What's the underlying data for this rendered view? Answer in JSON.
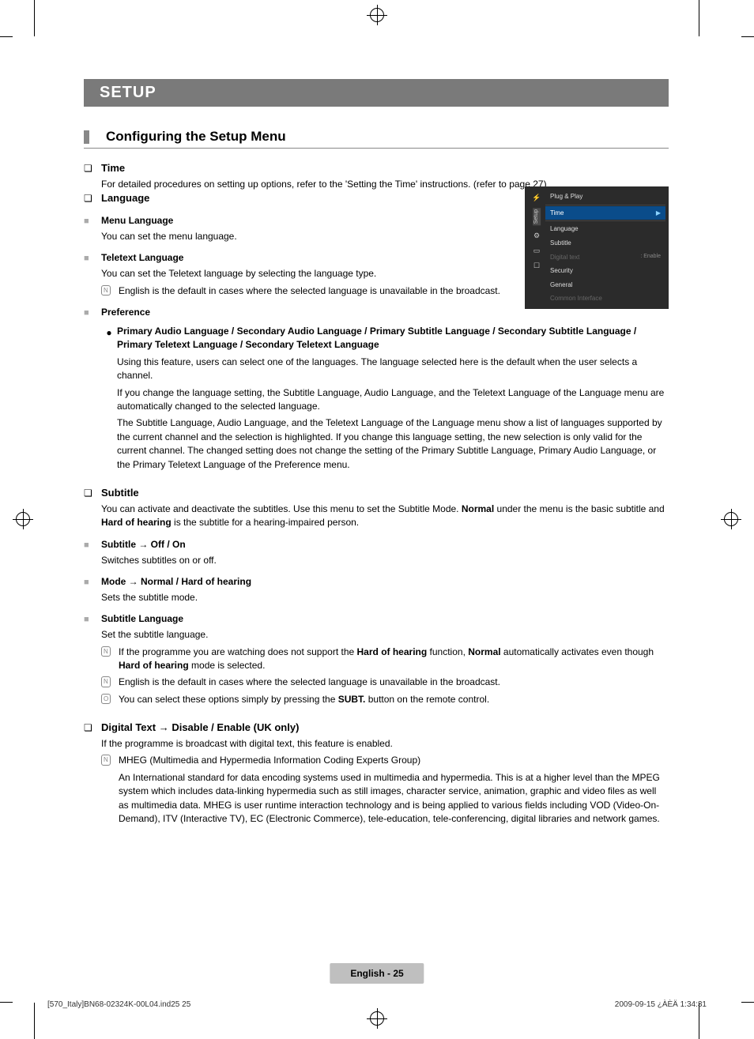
{
  "header": {
    "bar": "SETUP",
    "heading": "Configuring the Setup Menu"
  },
  "time": {
    "title": "Time",
    "body": "For detailed procedures on setting up options, refer to the 'Setting the Time' instructions. (refer to page 27)"
  },
  "language": {
    "title": "Language",
    "menuLang": {
      "title": "Menu Language",
      "body": "You can set the menu language."
    },
    "teletextLang": {
      "title": "Teletext Language",
      "body": "You can set the Teletext language by selecting the language type.",
      "note": "English is the default in cases where the selected language is unavailable in the broadcast."
    },
    "preference": {
      "title": "Preference",
      "bulletHead": "Primary Audio Language / Secondary Audio Language / Primary Subtitle Language / Secondary Subtitle Language / Primary Teletext Language / Secondary Teletext Language",
      "p1": "Using this feature, users can select one of the languages. The language selected here is the default when the user selects a channel.",
      "p2": "If you change the language setting, the Subtitle Language, Audio Language, and the Teletext Language of the Language menu are automatically changed to the selected language.",
      "p3": "The Subtitle Language, Audio Language, and the Teletext Language of the Language menu show a list of languages supported by the current channel and the selection is highlighted. If you change this language setting, the new selection is only valid for the current channel. The changed setting does not change the setting of the Primary Subtitle Language, Primary Audio Language, or the Primary Teletext Language of the Preference menu."
    }
  },
  "subtitle": {
    "title": "Subtitle",
    "intro_a": "You can activate and deactivate the subtitles. Use this menu to set the Subtitle Mode. ",
    "intro_b": "Normal",
    "intro_c": " under the menu is the basic subtitle and ",
    "intro_d": "Hard of hearing",
    "intro_e": " is the subtitle for a hearing-impaired person.",
    "offOn": {
      "title": "Subtitle → Off / On",
      "body": "Switches subtitles on or off."
    },
    "mode": {
      "title": "Mode → Normal / Hard of hearing",
      "body": "Sets the subtitle mode."
    },
    "subtLang": {
      "title": "Subtitle Language",
      "body": "Set the subtitle language.",
      "n1a": "If the programme you are watching does not support the ",
      "n1b": "Hard of hearing",
      "n1c": " function, ",
      "n1d": "Normal",
      "n1e": " automatically activates even though ",
      "n1f": "Hard of hearing",
      "n1g": " mode is selected.",
      "n2": "English is the default in cases where the selected language is unavailable in the broadcast.",
      "n3a": "You can select these options simply by pressing the ",
      "n3b": "SUBT.",
      "n3c": " button on the remote control."
    }
  },
  "digitalText": {
    "title": "Digital Text → Disable / Enable (UK only)",
    "body": "If the programme is broadcast with digital text, this feature is enabled.",
    "mhegHead": "MHEG (Multimedia and Hypermedia Information Coding Experts Group)",
    "mhegBody": "An International standard for data encoding systems used in multimedia and hypermedia. This is at a higher level than the MPEG system which includes data-linking hypermedia such as still images, character service, animation, graphic and video files as well as multimedia data. MHEG is user runtime interaction technology and is being applied to various fields including VOD (Video-On-Demand), ITV (Interactive TV), EC (Electronic Commerce), tele-education, tele-conferencing, digital libraries and network games."
  },
  "osd": {
    "sideLabel": "Setup",
    "items": [
      {
        "label": "Plug & Play"
      },
      {
        "label": "Time",
        "selected": true
      },
      {
        "label": "Language"
      },
      {
        "label": "Subtitle"
      },
      {
        "label": "Digital text",
        "value": ": Enable",
        "dim": true
      },
      {
        "label": "Security"
      },
      {
        "label": "General"
      },
      {
        "label": "Common Interface",
        "dim": true
      }
    ]
  },
  "footer": {
    "pill": "English - 25",
    "left": "[570_Italy]BN68-02324K-00L04.ind25   25",
    "right": "2009-09-15   ¿ÀÈÄ 1:34:31"
  },
  "sym": {
    "q": "❏",
    "square": "■",
    "bullet": "●",
    "note": "N",
    "tool": "O"
  }
}
